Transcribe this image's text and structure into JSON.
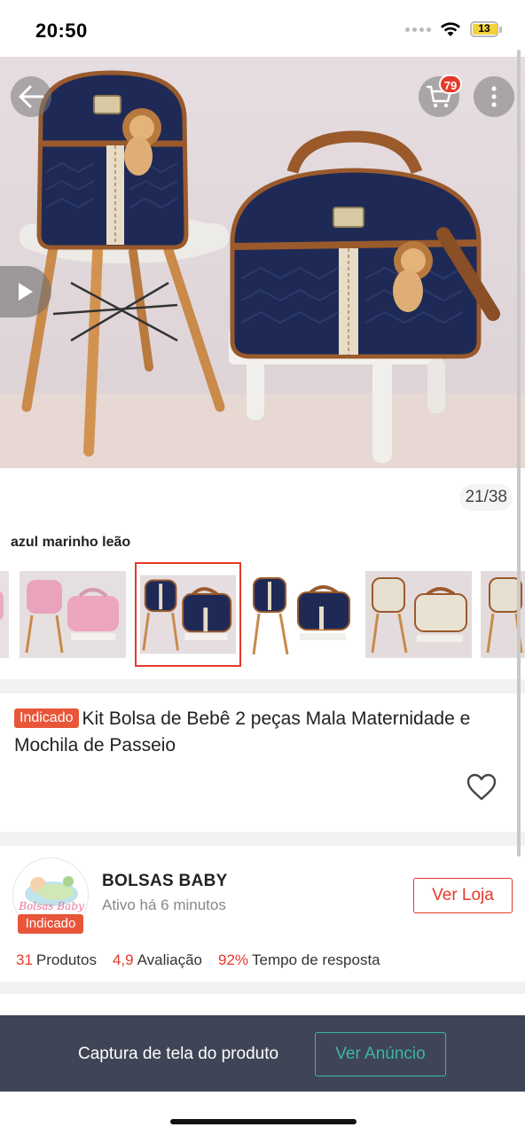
{
  "status_bar": {
    "time": "20:50",
    "battery": "13"
  },
  "gallery": {
    "counter": "21/38",
    "variant_name": "azul marinho leão"
  },
  "header": {
    "cart_count": "79"
  },
  "colors": {
    "accent": "#e4392b",
    "tag": "#e8563a",
    "footer_bg": "#3f4556",
    "footer_accent": "#3ab7a1",
    "navy": "#1e2a55",
    "caramel": "#9a5a2c"
  },
  "icons": [
    "back-arrow-icon",
    "cart-icon",
    "more-vert-icon",
    "play-icon",
    "heart-icon",
    "wifi-icon",
    "battery-icon"
  ],
  "product": {
    "tag": "Indicado",
    "title": "Kit Bolsa de Bebê 2 peças Mala Maternidade e Mochila de Passeio"
  },
  "shop": {
    "name": "BOLSAS BABY",
    "status": "Ativo há 6 minutos",
    "tag": "Indicado",
    "logo_text": "Bolsas Baby",
    "button": "Ver Loja",
    "stats": [
      {
        "value": "31",
        "label": "Produtos"
      },
      {
        "value": "4,9",
        "label": "Avaliação"
      },
      {
        "value": "92%",
        "label": "Tempo de resposta"
      }
    ]
  },
  "footer": {
    "text": "Captura de tela do produto",
    "button": "Ver Anúncio"
  }
}
